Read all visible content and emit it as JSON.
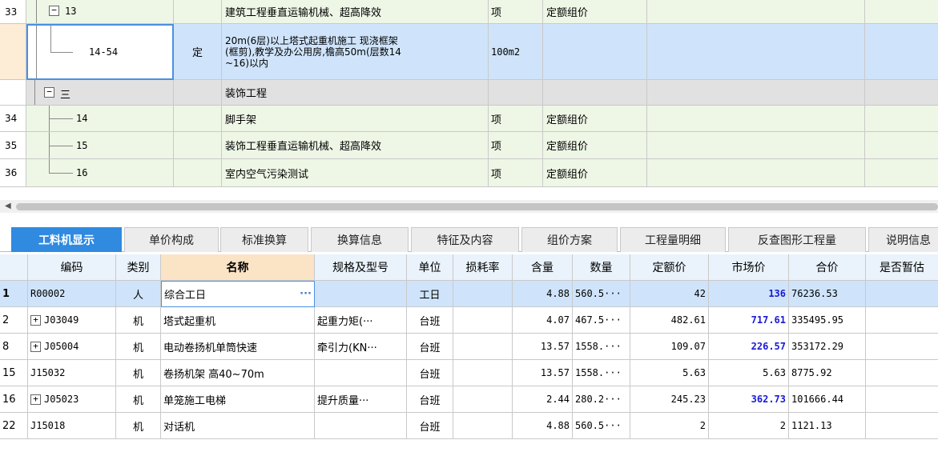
{
  "tree_rows": [
    {
      "num": "33",
      "code": "13",
      "type": "",
      "name": "建筑工程垂直运输机械、超高降效",
      "unit": "项",
      "method": "定额组价"
    },
    {
      "num": "",
      "code": "14-54",
      "type": "定",
      "name_lines": [
        "20m(6层)以上塔式起重机施工 现浇框架",
        "(框剪),教学及办公用房,檐高50m(层数14",
        "~16)以内"
      ],
      "unit": "100m2",
      "method": ""
    },
    {
      "num": "",
      "code": "三",
      "type": "",
      "name": "装饰工程",
      "unit": "",
      "method": ""
    },
    {
      "num": "34",
      "code": "14",
      "type": "",
      "name": "脚手架",
      "unit": "项",
      "method": "定额组价"
    },
    {
      "num": "35",
      "code": "15",
      "type": "",
      "name": "装饰工程垂直运输机械、超高降效",
      "unit": "项",
      "method": "定额组价"
    },
    {
      "num": "36",
      "code": "16",
      "type": "",
      "name": "室内空气污染测试",
      "unit": "项",
      "method": "定额组价"
    }
  ],
  "tabs": [
    "工料机显示",
    "单价构成",
    "标准换算",
    "换算信息",
    "特征及内容",
    "组价方案",
    "工程量明细",
    "反查图形工程量",
    "说明信息"
  ],
  "columns": [
    "编码",
    "类别",
    "名称",
    "规格及型号",
    "单位",
    "损耗率",
    "含量",
    "数量",
    "定额价",
    "市场价",
    "合价",
    "是否暂估"
  ],
  "rows": [
    {
      "idx": "1",
      "code": "R00002",
      "cat": "人",
      "name": "综合工日",
      "spec": "",
      "unit": "工日",
      "loss": "",
      "qty": "4.88",
      "amount": "560.5···",
      "quota": "42",
      "market": "136",
      "total": "76236.53",
      "est": ""
    },
    {
      "idx": "2",
      "code": "J03049",
      "cat": "机",
      "name": "塔式起重机",
      "spec": "起重力矩(···",
      "unit": "台班",
      "loss": "",
      "qty": "4.07",
      "amount": "467.5···",
      "quota": "482.61",
      "market": "717.61",
      "total": "335495.95",
      "est": ""
    },
    {
      "idx": "8",
      "code": "J05004",
      "cat": "机",
      "name": "电动卷扬机单筒快速",
      "spec": "牵引力(KN···",
      "unit": "台班",
      "loss": "",
      "qty": "13.57",
      "amount": "1558.···",
      "quota": "109.07",
      "market": "226.57",
      "total": "353172.29",
      "est": ""
    },
    {
      "idx": "15",
      "code": "J15032",
      "cat": "机",
      "name": "卷扬机架 高40~70m",
      "spec": "",
      "unit": "台班",
      "loss": "",
      "qty": "13.57",
      "amount": "1558.···",
      "quota": "5.63",
      "market": "5.63",
      "total": "8775.92",
      "est": ""
    },
    {
      "idx": "16",
      "code": "J05023",
      "cat": "机",
      "name": "单笼施工电梯",
      "spec": "提升质量···",
      "unit": "台班",
      "loss": "",
      "qty": "2.44",
      "amount": "280.2···",
      "quota": "245.23",
      "market": "362.73",
      "total": "101666.44",
      "est": ""
    },
    {
      "idx": "22",
      "code": "J15018",
      "cat": "机",
      "name": "对话机",
      "spec": "",
      "unit": "台班",
      "loss": "",
      "qty": "4.88",
      "amount": "560.5···",
      "quota": "2",
      "market": "2",
      "total": "1121.13",
      "est": ""
    }
  ],
  "glyphs": {
    "minus": "−",
    "plus": "+",
    "ellipsis": "···",
    "scroll_left": "◀"
  }
}
